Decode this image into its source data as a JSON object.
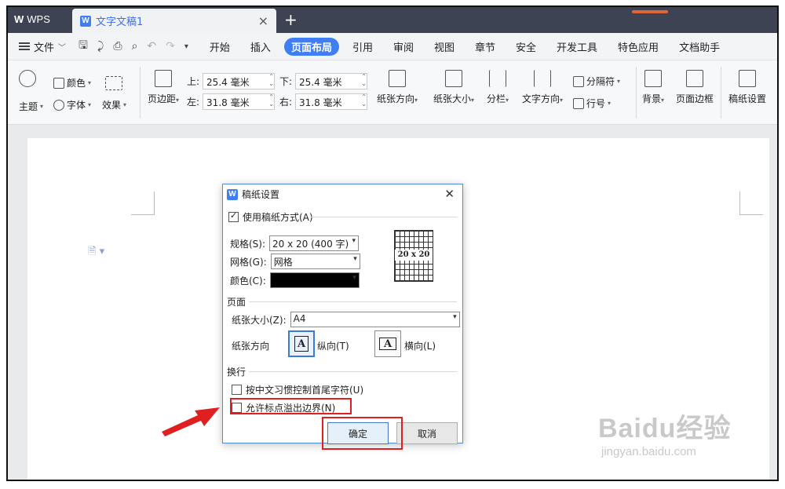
{
  "titlebar": {
    "app_name": "WPS",
    "doc_tab": "文字文稿1",
    "close": "×",
    "new_tab": "+"
  },
  "menubar": {
    "file_label": "文件",
    "tabs": [
      "开始",
      "插入",
      "页面布局",
      "引用",
      "审阅",
      "视图",
      "章节",
      "安全",
      "开发工具",
      "特色应用",
      "文档助手"
    ],
    "active_tab": "页面布局"
  },
  "ribbon": {
    "theme": "主题",
    "color": "颜色",
    "font": "字体",
    "effect": "效果",
    "margins": "页边距",
    "top_label": "上:",
    "top_value": "25.4 毫米",
    "bottom_label": "下:",
    "bottom_value": "25.4 毫米",
    "left_label": "左:",
    "left_value": "31.8 毫米",
    "right_label": "右:",
    "right_value": "31.8 毫米",
    "orientation": "纸张方向",
    "size": "纸张大小",
    "columns": "分栏",
    "text_direction": "文字方向",
    "separator": "分隔符",
    "line_number": "行号",
    "background": "背景",
    "page_border": "页面边框",
    "manuscript": "稿纸设置"
  },
  "dialog": {
    "title": "稿纸设置",
    "use_manuscript": "使用稿纸方式(A)",
    "use_manuscript_checked": true,
    "spec_label": "规格(S):",
    "spec_value": "20 x 20 (400 字)",
    "grid_label": "网格(G):",
    "grid_value": "网格",
    "color_label": "颜色(C):",
    "preview_text": "20 x 20",
    "page_section": "页面",
    "paper_size_label": "纸张大小(Z):",
    "paper_size_value": "A4",
    "orientation_label": "纸张方向",
    "portrait": "纵向(T)",
    "landscape": "横向(L)",
    "wrap_section": "换行",
    "opt_chinese": "按中文习惯控制首尾字符(U)",
    "opt_overflow": "允许标点溢出边界(N)",
    "ok": "确定",
    "cancel": "取消"
  },
  "watermark": {
    "line1": "Baidu经验",
    "line2": "jingyan.baidu.com"
  },
  "colors": {
    "accent": "#3f7ef5",
    "titlebar": "#3d4352",
    "highlight": "#e02020"
  }
}
